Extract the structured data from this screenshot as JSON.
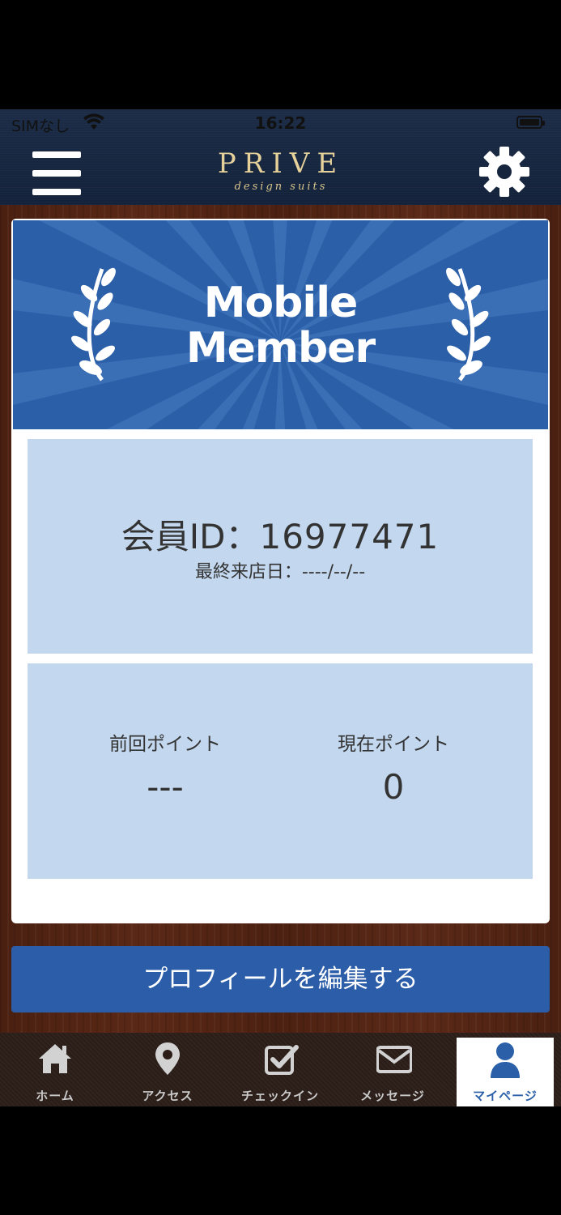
{
  "status_bar": {
    "carrier": "SIMなし",
    "time": "16:22"
  },
  "header": {
    "logo_main": "PRIVE",
    "logo_sub": "design suits"
  },
  "banner": {
    "title_line1": "Mobile",
    "title_line2": "Member"
  },
  "member": {
    "id_label": "会員ID：",
    "id_value": "16977471",
    "last_visit": "最終来店日：----/--/--"
  },
  "points": {
    "previous_label": "前回ポイント",
    "previous_value": "---",
    "current_label": "現在ポイント",
    "current_value": "0"
  },
  "edit_profile_label": "プロフィールを編集する",
  "tabs": [
    {
      "label": "ホーム",
      "icon": "home-icon"
    },
    {
      "label": "アクセス",
      "icon": "map-pin-icon"
    },
    {
      "label": "チェックイン",
      "icon": "checkbox-icon"
    },
    {
      "label": "メッセージ",
      "icon": "envelope-icon"
    },
    {
      "label": "マイページ",
      "icon": "user-icon"
    }
  ],
  "colors": {
    "accent": "#2c5da8",
    "panel": "#c3d8ef",
    "logo_gold": "#e6d19a"
  }
}
